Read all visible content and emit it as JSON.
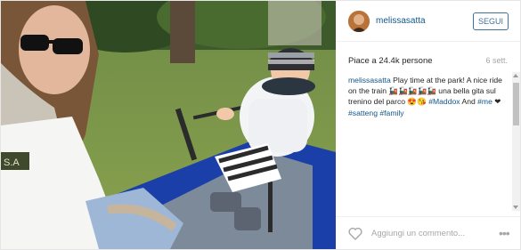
{
  "post": {
    "username": "melissasatta",
    "follow_label": "SEGUI",
    "likes": "Piace a 24.4k persone",
    "time": "6 sett.",
    "caption": {
      "user": "melissasatta",
      "line1": " Play time at the park! A nice ride on the train ",
      "blurred": "🚂🚂🚂🚂🚂",
      "line2": " una bella gita sul trenino del parco 😍😘 ",
      "tag1": "#Maddox",
      "line3": " And ",
      "tag2": "#me",
      "heart": " ❤ ",
      "tag3": "#satteng",
      "tag4": "#family"
    },
    "comment_placeholder": "Aggiungi un commento...",
    "more_label": "•••",
    "jacket_text": "S.A"
  },
  "colors": {
    "link": "#125688",
    "follow_border": "#3f729b",
    "muted": "#a5a7aa"
  },
  "icons": [
    "avatar",
    "heart-icon",
    "more-options-icon"
  ]
}
